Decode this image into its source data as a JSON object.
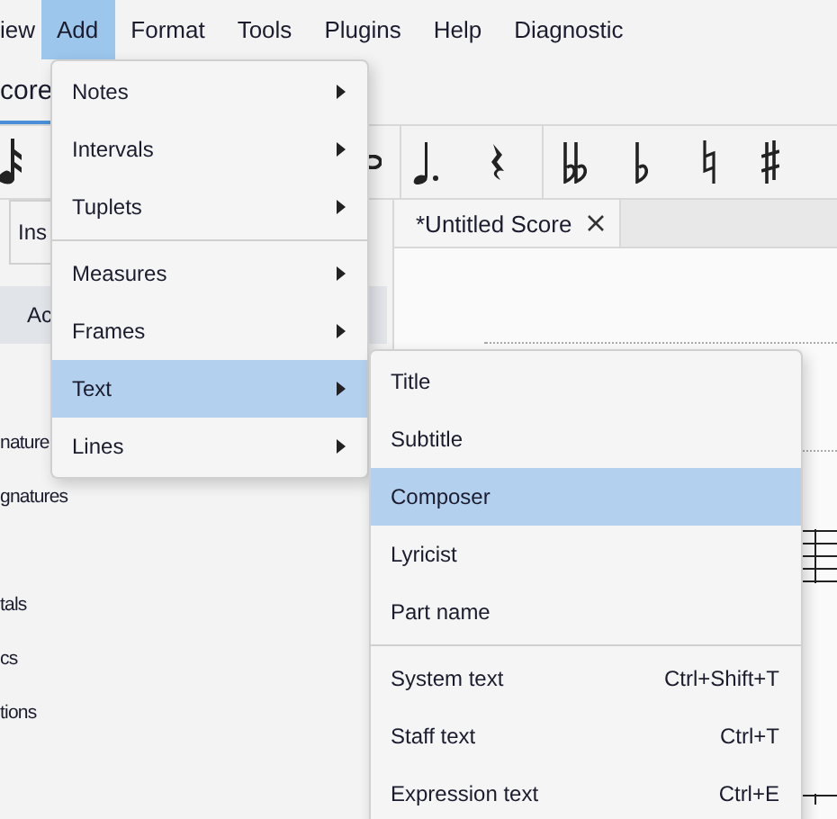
{
  "menubar": [
    {
      "label": "iew",
      "selected": false
    },
    {
      "label": "Add",
      "selected": true
    },
    {
      "label": "Format",
      "selected": false
    },
    {
      "label": "Tools",
      "selected": false
    },
    {
      "label": "Plugins",
      "selected": false
    },
    {
      "label": "Help",
      "selected": false
    },
    {
      "label": "Diagnostic",
      "selected": false
    }
  ],
  "workspace_tab": {
    "label": "core",
    "selected": true
  },
  "palette_panel": {
    "tab": "Ins",
    "button": "Ac",
    "groups": [
      [
        "nature",
        "gnatures"
      ],
      [
        "tals",
        "cs",
        "tions"
      ]
    ]
  },
  "document_tab": {
    "title": "*Untitled Score"
  },
  "add_menu": {
    "groups": [
      [
        {
          "label": "Notes",
          "selected": false
        },
        {
          "label": "Intervals",
          "selected": false
        },
        {
          "label": "Tuplets",
          "selected": false
        }
      ],
      [
        {
          "label": "Measures",
          "selected": false
        },
        {
          "label": "Frames",
          "selected": false
        },
        {
          "label": "Text",
          "selected": true
        },
        {
          "label": "Lines",
          "selected": false
        }
      ]
    ]
  },
  "text_submenu": {
    "groups": [
      [
        {
          "label": "Title",
          "selected": false
        },
        {
          "label": "Subtitle",
          "selected": false
        },
        {
          "label": "Composer",
          "selected": true
        },
        {
          "label": "Lyricist",
          "selected": false
        },
        {
          "label": "Part name",
          "selected": false
        }
      ],
      [
        {
          "label": "System text",
          "shortcut": "Ctrl+Shift+T",
          "selected": false
        },
        {
          "label": "Staff text",
          "shortcut": "Ctrl+T",
          "selected": false
        },
        {
          "label": "Expression text",
          "shortcut": "Ctrl+E",
          "selected": false
        }
      ]
    ]
  }
}
